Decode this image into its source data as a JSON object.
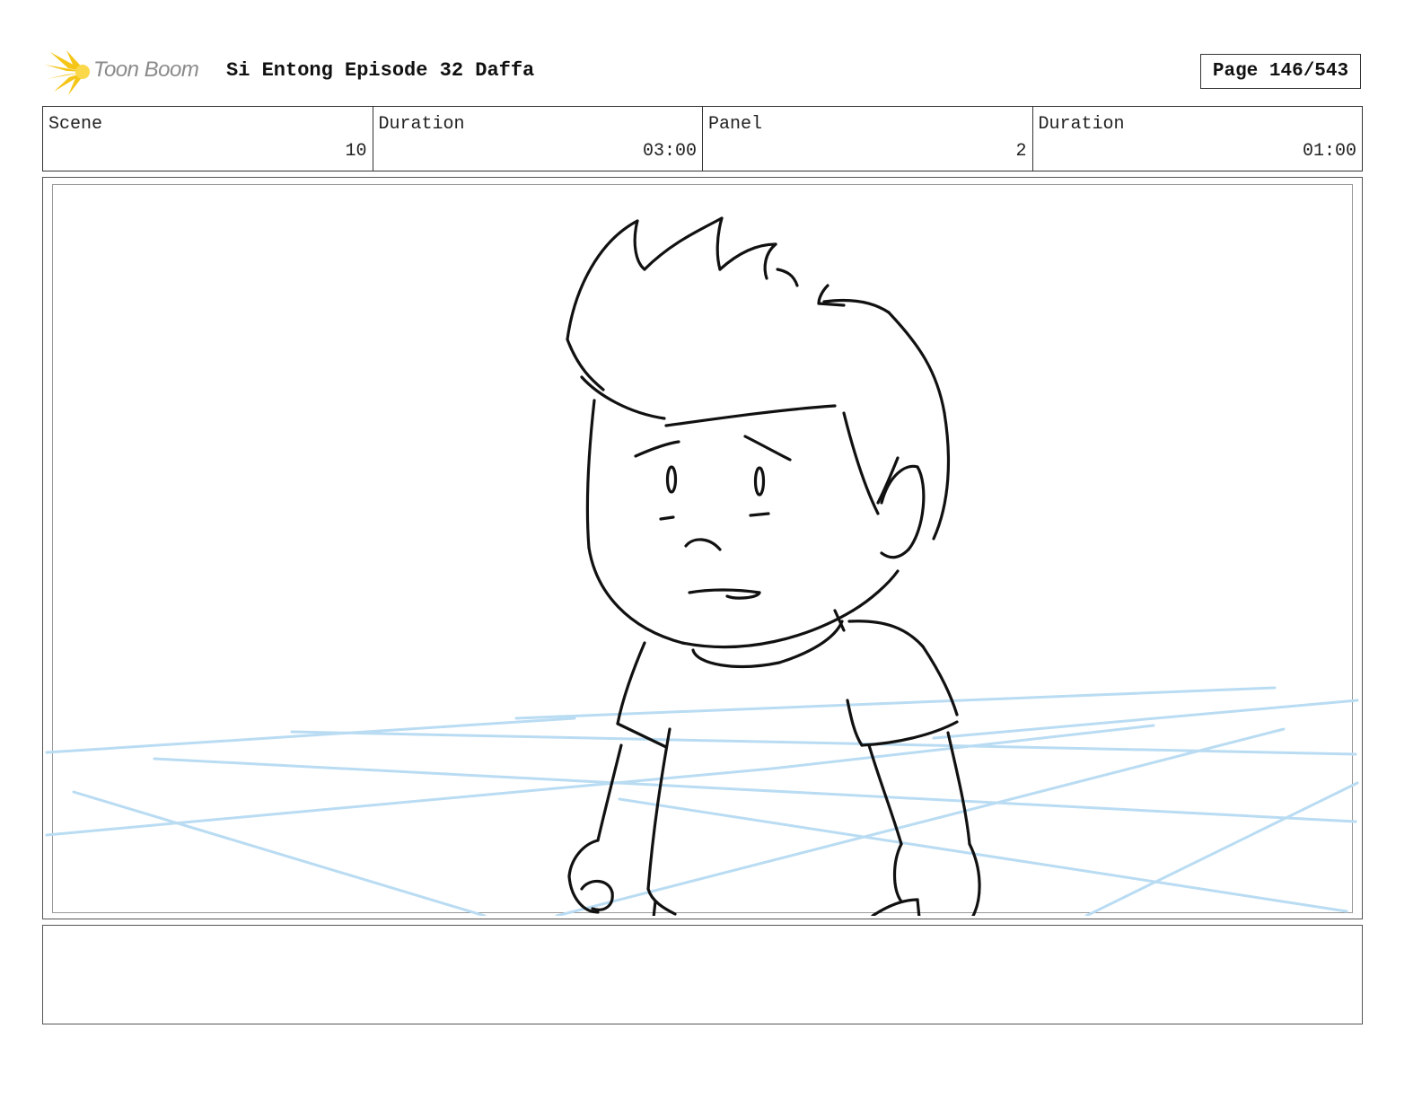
{
  "header": {
    "logo_text": "Toon Boom",
    "title": "Si Entong Episode 32 Daffa",
    "page": "Page 146/543"
  },
  "info": {
    "scene_label": "Scene",
    "scene_value": "10",
    "scene_duration_label": "Duration",
    "scene_duration_value": "03:00",
    "panel_label": "Panel",
    "panel_value": "2",
    "panel_duration_label": "Duration",
    "panel_duration_value": "01:00"
  },
  "notes": {
    "text": ""
  },
  "colors": {
    "logo_accent": "#f5c518",
    "guide_lines": "#b9dcf3",
    "ink": "#111111"
  }
}
